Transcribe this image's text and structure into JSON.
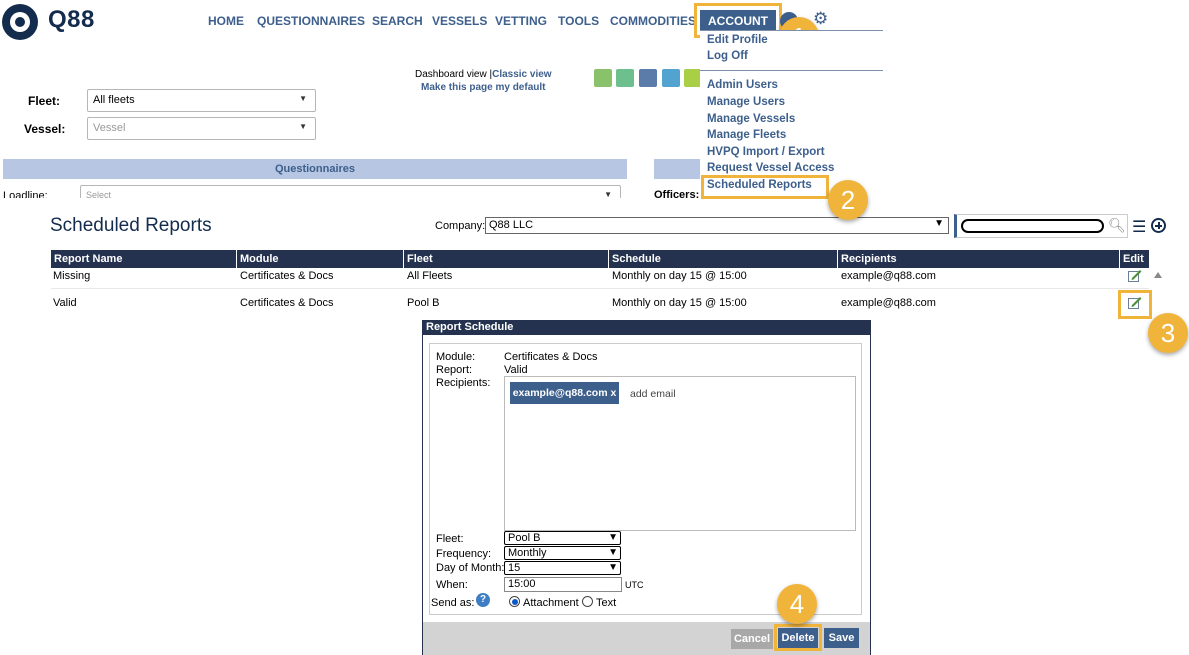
{
  "brand": {
    "name": "Q88"
  },
  "nav": {
    "items": [
      "HOME",
      "QUESTIONNAIRES",
      "SEARCH",
      "VESSELS",
      "VETTING",
      "TOOLS",
      "COMMODITIES"
    ],
    "account": "ACCOUNT"
  },
  "account_menu": {
    "group1": [
      "Edit Profile",
      "Log Off"
    ],
    "group2": [
      "Admin Users",
      "Manage Users",
      "Manage Vessels",
      "Manage Fleets",
      "HVPQ Import / Export",
      "Request Vessel Access",
      "Scheduled Reports"
    ]
  },
  "steps": [
    "1",
    "2",
    "3",
    "4"
  ],
  "dashboard": {
    "fleet_label": "Fleet:",
    "fleet_value": "All fleets",
    "vessel_label": "Vessel:",
    "vessel_placeholder": "Vessel",
    "view_text": "Dashboard view |",
    "classic_link": "Classic view",
    "default_link": "Make this page my default",
    "questionnaires_header": "Questionnaires",
    "loadline_label": "Loadline:",
    "loadline_placeholder": "Select",
    "officers_label": "Officers:"
  },
  "scheduled_reports": {
    "title": "Scheduled Reports",
    "company_label": "Company:",
    "company_value": "Q88 LLC",
    "columns": [
      "Report Name",
      "Module",
      "Fleet",
      "Schedule",
      "Recipients",
      "Edit"
    ],
    "rows": [
      {
        "name": "Missing",
        "module": "Certificates & Docs",
        "fleet": "All Fleets",
        "schedule": "Monthly on day 15 @ 15:00",
        "recipients": "example@q88.com"
      },
      {
        "name": "Valid",
        "module": "Certificates & Docs",
        "fleet": "Pool B",
        "schedule": "Monthly on day 15 @ 15:00",
        "recipients": "example@q88.com"
      }
    ]
  },
  "dialog": {
    "title": "Report Schedule",
    "module_label": "Module:",
    "module_value": "Certificates & Docs",
    "report_label": "Report:",
    "report_value": "Valid",
    "recipients_label": "Recipients:",
    "recipient_chip": "example@q88.com x",
    "add_email": "add email",
    "fleet_label": "Fleet:",
    "fleet_value": "Pool B",
    "frequency_label": "Frequency:",
    "frequency_value": "Monthly",
    "day_label": "Day of Month:",
    "day_value": "15",
    "when_label": "When:",
    "when_value": "15:00",
    "tz": "UTC",
    "send_as_label": "Send as:",
    "send_attachment": "Attachment",
    "send_text": "Text",
    "help_glyph": "?",
    "cancel": "Cancel",
    "delete": "Delete",
    "save": "Save"
  },
  "colors": {
    "navy": "#24324f",
    "accent": "#3d5f8c",
    "highlight": "#f1b43b",
    "section_header": "#b6c6e3"
  }
}
